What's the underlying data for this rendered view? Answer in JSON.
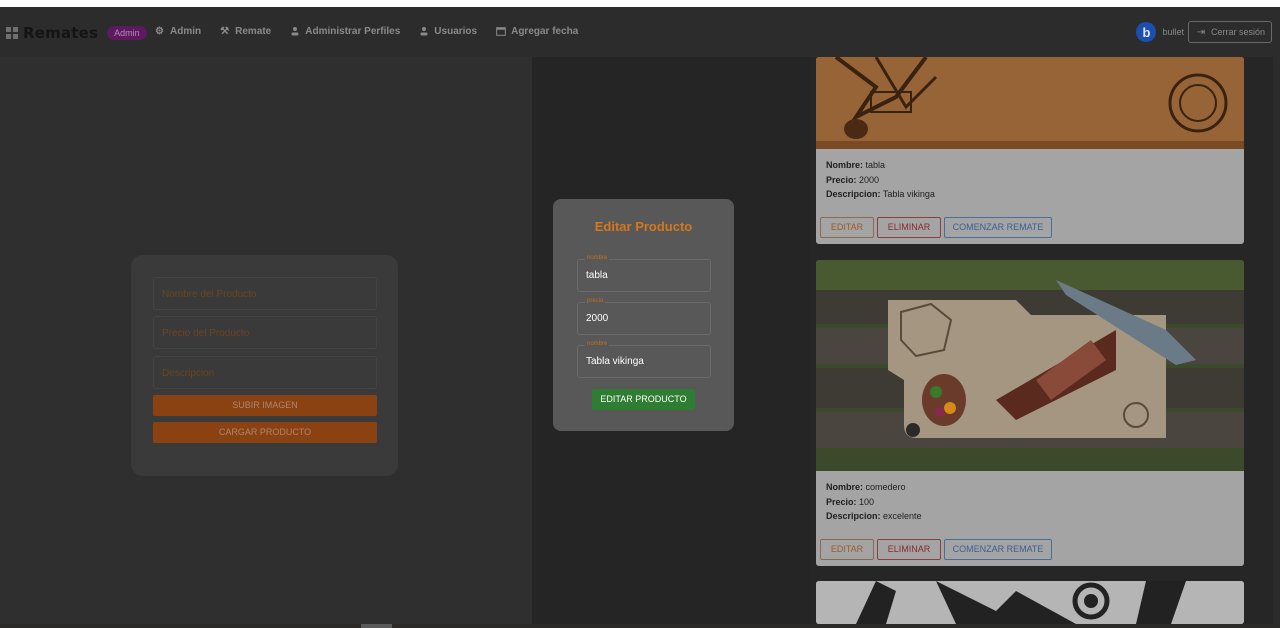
{
  "navbar": {
    "brand": "Remates",
    "badge": "Admin",
    "items": [
      {
        "label": "Admin",
        "icon": "gear-icon",
        "glyph": "⚙"
      },
      {
        "label": "Remate",
        "icon": "gavel-icon",
        "glyph": "⚒"
      },
      {
        "label": "Administrar Perfiles",
        "icon": "person-icon",
        "glyph": "👤"
      },
      {
        "label": "Usuarios",
        "icon": "person-icon",
        "glyph": "👤"
      },
      {
        "label": "Agregar fecha",
        "icon": "calendar-icon",
        "glyph": "📅"
      }
    ],
    "user_initial": "b",
    "username": "bullet",
    "logout_label": "Cerrar sesión",
    "logout_glyph": "⇥"
  },
  "add_form": {
    "name_placeholder": "Nombre del Producto",
    "price_placeholder": "Precio del Producto",
    "desc_placeholder": "Descripcion",
    "upload_label": "SUBIR IMAGEN",
    "submit_label": "CARGAR PRODUCTO"
  },
  "edit_modal": {
    "title": "Editar Producto",
    "fields": [
      {
        "label": "nombre",
        "value": "tabla"
      },
      {
        "label": "precio",
        "value": "2000"
      },
      {
        "label": "nombre",
        "value": "Tabla vikinga"
      }
    ],
    "submit_label": "EDITAR PRODUCTO"
  },
  "product_labels": {
    "name": "Nombre:",
    "price": "Precio:",
    "desc": "Descripcion:",
    "edit": "EDITAR",
    "delete": "ELIMINAR",
    "start": "COMENZAR REMATE"
  },
  "products": [
    {
      "name": "tabla",
      "price": "2000",
      "desc": "Tabla vikinga"
    },
    {
      "name": "comedero",
      "price": "100",
      "desc": "excelente"
    }
  ],
  "colors": {
    "accent_orange": "#d5771c",
    "accent_green": "#2e7d32",
    "accent_blue": "#1a4fb0"
  }
}
